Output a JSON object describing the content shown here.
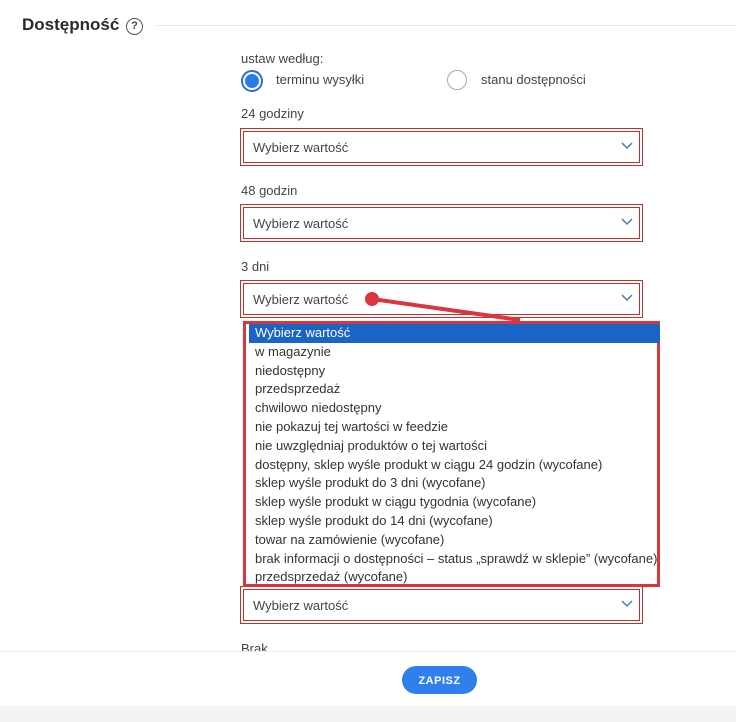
{
  "section": {
    "title": "Dostępność",
    "help_icon": "question-circle-icon"
  },
  "availability_mode": {
    "label": "ustaw według:",
    "options": [
      {
        "label": "terminu wysyłki",
        "selected": true
      },
      {
        "label": "stanu dostępności",
        "selected": false
      }
    ]
  },
  "fields": [
    {
      "label": "24 godziny",
      "value": "Wybierz wartość"
    },
    {
      "label": "48 godzin",
      "value": "Wybierz wartość"
    },
    {
      "label": "3 dni",
      "value": "Wybierz wartość"
    },
    {
      "label": "",
      "value": "Wybierz wartość"
    },
    {
      "label": "Brak",
      "value": ""
    }
  ],
  "dropdown": {
    "options": [
      "Wybierz wartość",
      "w magazynie",
      "niedostępny",
      "przedsprzedaż",
      "chwilowo niedostępny",
      "nie pokazuj tej wartości w feedzie",
      "nie uwzględniaj produktów o tej wartości",
      "dostępny, sklep wyśle produkt w ciągu 24 godzin (wycofane)",
      "sklep wyśle produkt do 3 dni (wycofane)",
      "sklep wyśle produkt w ciągu tygodnia (wycofane)",
      "sklep wyśle produkt do 14 dni (wycofane)",
      "towar na zamówienie (wycofane)",
      "brak informacji o dostępności – status „sprawdź w sklepie” (wycofane)",
      "przedsprzedaż (wycofane)"
    ],
    "selected_index": 0
  },
  "footer": {
    "save_label": "ZAPISZ"
  },
  "colors": {
    "accent": "#2f80ed",
    "error": "#c9302c",
    "annotation": "#d9363e"
  }
}
